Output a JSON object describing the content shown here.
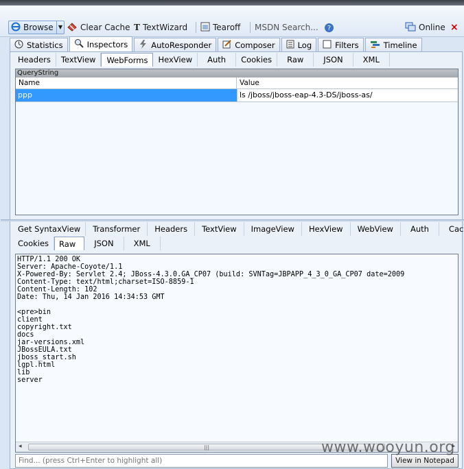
{
  "toolbar": {
    "browse": "Browse",
    "clear_cache": "Clear Cache",
    "textwizard": "TextWizard",
    "tearoff": "Tearoff",
    "msdn_search": "MSDN Search...",
    "online": "Online",
    "close": "×"
  },
  "main_tabs": [
    "Statistics",
    "Inspectors",
    "AutoResponder",
    "Composer",
    "Log",
    "Filters",
    "Timeline"
  ],
  "request_tabs": [
    "Headers",
    "TextView",
    "WebForms",
    "HexView",
    "Auth",
    "Cookies",
    "Raw",
    "JSON",
    "XML"
  ],
  "querystring": {
    "title": "QueryString",
    "col_name": "Name",
    "col_value": "Value",
    "rows": [
      {
        "name": "ppp",
        "value": "ls /jboss/jboss-eap-4.3-DS/jboss-as/"
      }
    ]
  },
  "response_tabs_row1": [
    "Get SyntaxView",
    "Transformer",
    "Headers",
    "TextView",
    "ImageView",
    "HexView",
    "WebView",
    "Auth",
    "Caching"
  ],
  "response_tabs_row2": [
    "Cookies",
    "Raw",
    "JSON",
    "XML"
  ],
  "response_raw": "HTTP/1.1 200 OK\nServer: Apache-Coyote/1.1\nX-Powered-By: Servlet 2.4; JBoss-4.3.0.GA_CP07 (build: SVNTag=JBPAPP_4_3_0_GA_CP07 date=2009\nContent-Type: text/html;charset=ISO-8859-1\nContent-Length: 102\nDate: Thu, 14 Jan 2016 14:34:53 GMT\n\n<pre>bin\nclient\ncopyright.txt\ndocs\njar-versions.xml\nJBossEULA.txt\njboss_start.sh\nlgpl.html\nlib\nserver",
  "find_placeholder": "Find... (press Ctrl+Enter to highlight all)",
  "view_in_notepad": "View in Notepad",
  "watermark": "www.wooyun.org",
  "colors": {
    "selected_row": "#3399ff",
    "panel_bg": "#ebf1f9",
    "close": "#cc0000"
  },
  "icons": [
    "browse-ie-icon",
    "clear-cache-icon",
    "textwizard-icon",
    "tearoff-icon",
    "msdn-help-icon",
    "online-icon",
    "close-icon",
    "statistics-icon",
    "inspectors-icon",
    "autoresponder-icon",
    "composer-icon",
    "log-icon",
    "filters-icon",
    "timeline-icon"
  ]
}
